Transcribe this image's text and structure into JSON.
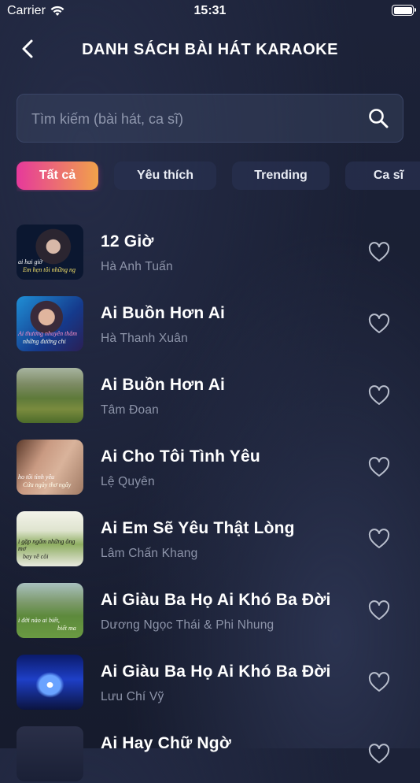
{
  "status": {
    "carrier": "Carrier",
    "time": "15:31"
  },
  "header": {
    "title": "DANH SÁCH BÀI HÁT KARAOKE"
  },
  "search": {
    "placeholder": "Tìm kiếm (bài hát, ca sĩ)"
  },
  "tabs": [
    {
      "label": "Tất cả",
      "active": true
    },
    {
      "label": "Yêu thích",
      "active": false
    },
    {
      "label": "Trending",
      "active": false
    },
    {
      "label": "Ca sĩ",
      "active": false
    }
  ],
  "songs": [
    {
      "title": "12 Giờ",
      "artist": "Hà Anh Tuấn",
      "cap1": "ai hai giờ",
      "cap2": "Em hẹn tôi những ng"
    },
    {
      "title": "Ai Buồn Hơn Ai",
      "artist": "Hà Thanh Xuân",
      "cap1": "Ai thương nhuyên thắm",
      "cap2": "những đường chi"
    },
    {
      "title": "Ai Buồn Hơn Ai",
      "artist": "Tâm Đoan",
      "cap1": "",
      "cap2": ""
    },
    {
      "title": "Ai Cho Tôi Tình Yêu",
      "artist": "Lệ Quyên",
      "cap1": "ho tôi tình yêu",
      "cap2": "Cứa ngày thơ ngây"
    },
    {
      "title": "Ai Em Sẽ Yêu Thật Lòng",
      "artist": "Lâm Chấn Khang",
      "cap1": "i gặp ngấm những ông mơ",
      "cap2": "bay về cõi"
    },
    {
      "title": "Ai Giàu Ba Họ Ai Khó Ba Đời",
      "artist": "Dương Ngọc Thái & Phi Nhung",
      "cap1": "i đời nào ai biết,",
      "cap2": "biết ma"
    },
    {
      "title": "Ai Giàu Ba Họ Ai Khó Ba Đời",
      "artist": "Lưu Chí Vỹ",
      "cap1": "",
      "cap2": ""
    },
    {
      "title": "Ai Hay Chữ Ngờ",
      "artist": "",
      "cap1": "",
      "cap2": ""
    }
  ]
}
